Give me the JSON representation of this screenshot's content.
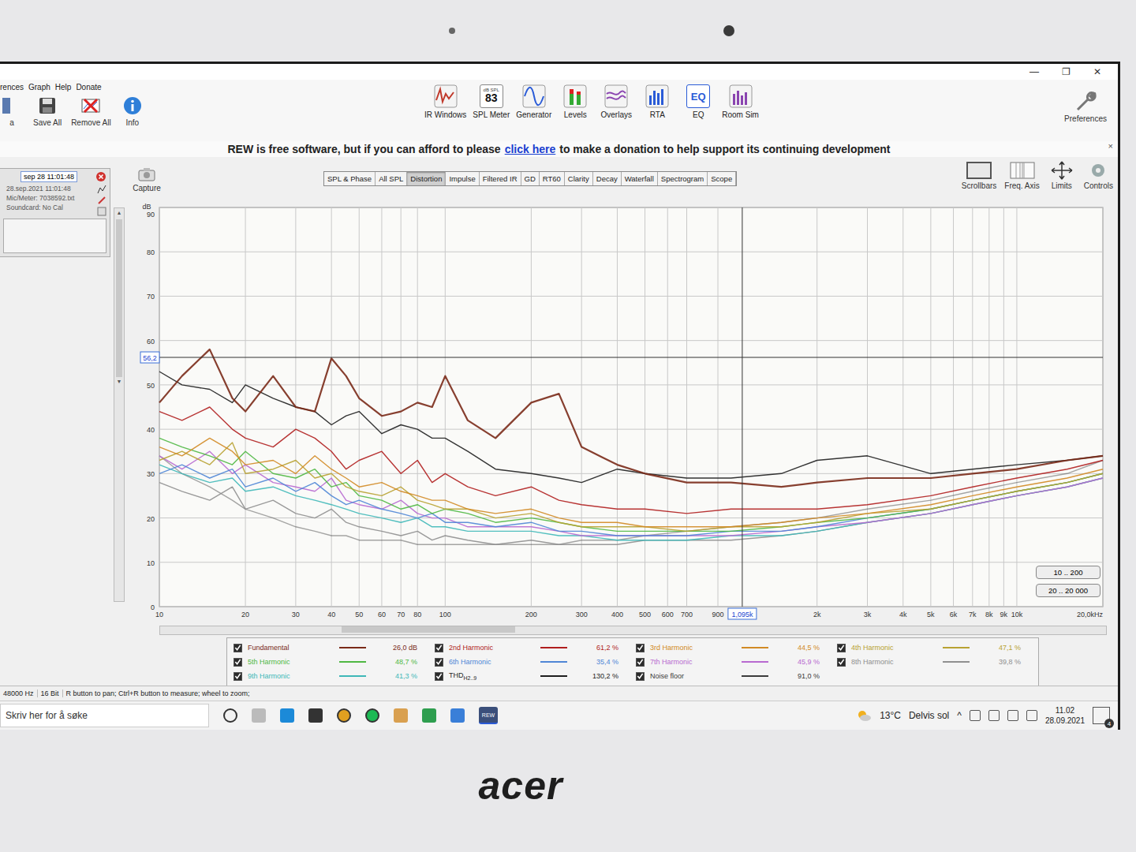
{
  "window": {
    "controls": [
      "—",
      "❐",
      "✕"
    ]
  },
  "menu": [
    "rences",
    "Graph",
    "Help",
    "Donate"
  ],
  "toolbar_left": [
    "a",
    "Save All",
    "Remove All",
    "Info"
  ],
  "tools": [
    {
      "label": "IR Windows",
      "icon_text": []
    },
    {
      "label": "SPL Meter",
      "icon_text": [
        "dB SPL",
        "83"
      ]
    },
    {
      "label": "Generator",
      "icon_text": []
    },
    {
      "label": "Levels",
      "icon_text": []
    },
    {
      "label": "Overlays",
      "icon_text": []
    },
    {
      "label": "RTA",
      "icon_text": []
    },
    {
      "label": "EQ",
      "icon_text": [
        "EQ"
      ]
    },
    {
      "label": "Room Sim",
      "icon_text": []
    }
  ],
  "preferences": "Preferences",
  "banner": {
    "before": "REW is free software, but if you can afford to please",
    "link": "click here",
    "after": "to make a donation to help support its continuing development",
    "close": "×"
  },
  "measurement": {
    "name": "sep 28 11:01:48",
    "lines": [
      "28.sep.2021 11:01:48",
      "Mic/Meter: 7038592.txt",
      "Soundcard: No Cal"
    ]
  },
  "capture": "Capture",
  "tabs": [
    {
      "label": "SPL & Phase",
      "selected": false
    },
    {
      "label": "All SPL",
      "selected": false
    },
    {
      "label": "Distortion",
      "selected": true
    },
    {
      "label": "Impulse",
      "selected": false
    },
    {
      "label": "Filtered IR",
      "selected": false
    },
    {
      "label": "GD",
      "selected": false
    },
    {
      "label": "RT60",
      "selected": false
    },
    {
      "label": "Clarity",
      "selected": false
    },
    {
      "label": "Decay",
      "selected": false
    },
    {
      "label": "Waterfall",
      "selected": false
    },
    {
      "label": "Spectrogram",
      "selected": false
    },
    {
      "label": "Scope",
      "selected": false
    }
  ],
  "graph_controls": [
    "Scrollbars",
    "Freq. Axis",
    "Limits",
    "Controls"
  ],
  "chart": {
    "y_label": "dB",
    "y_ticks": [
      "90",
      "80",
      "70",
      "60",
      "50",
      "40",
      "30",
      "20",
      "10",
      "0"
    ],
    "x_ticks": [
      {
        "label": "10",
        "hz": 10
      },
      {
        "label": "20",
        "hz": 20
      },
      {
        "label": "30",
        "hz": 30
      },
      {
        "label": "40",
        "hz": 40
      },
      {
        "label": "50",
        "hz": 50
      },
      {
        "label": "60",
        "hz": 60
      },
      {
        "label": "70",
        "hz": 70
      },
      {
        "label": "80",
        "hz": 80
      },
      {
        "label": "100",
        "hz": 100
      },
      {
        "label": "200",
        "hz": 200
      },
      {
        "label": "300",
        "hz": 300
      },
      {
        "label": "400",
        "hz": 400
      },
      {
        "label": "500",
        "hz": 500
      },
      {
        "label": "600",
        "hz": 600
      },
      {
        "label": "700",
        "hz": 700
      },
      {
        "label": "900",
        "hz": 900
      },
      {
        "label": "2k",
        "hz": 2000
      },
      {
        "label": "3k",
        "hz": 3000
      },
      {
        "label": "4k",
        "hz": 4000
      },
      {
        "label": "5k",
        "hz": 5000
      },
      {
        "label": "6k",
        "hz": 6000
      },
      {
        "label": "7k",
        "hz": 7000
      },
      {
        "label": "8k",
        "hz": 8000
      },
      {
        "label": "9k",
        "hz": 9000
      },
      {
        "label": "10k",
        "hz": 10000
      },
      {
        "label": "20,0kHz",
        "hz": 20000
      }
    ],
    "cursor": {
      "hz": 1095,
      "hz_label": "1,095k",
      "db": 56.2,
      "db_label": "56,2"
    },
    "range_buttons": [
      "10 .. 200",
      "20 .. 20 000"
    ],
    "freqs": [
      10,
      12,
      15,
      18,
      20,
      25,
      30,
      35,
      40,
      45,
      50,
      60,
      70,
      80,
      90,
      100,
      120,
      150,
      200,
      250,
      300,
      400,
      500,
      700,
      1000,
      1500,
      2000,
      3000,
      5000,
      7000,
      10000,
      15000,
      20000
    ],
    "series": [
      {
        "name": "Noise floor",
        "sub": "",
        "value": "91,0 %",
        "checked": true,
        "color": "#3c3c3c",
        "values": [
          34,
          30,
          27,
          24,
          22,
          20,
          18,
          17,
          16,
          16,
          15,
          15,
          15,
          14,
          14,
          14,
          14,
          14,
          14,
          14,
          15,
          15,
          16,
          17,
          18,
          19,
          20,
          22,
          24,
          26,
          28,
          30,
          33
        ]
      },
      {
        "name": "8th Harmonic",
        "sub": "",
        "value": "39,8 %",
        "checked": true,
        "color": "#8f8f8f",
        "values": [
          28,
          26,
          24,
          27,
          22,
          24,
          21,
          20,
          22,
          19,
          18,
          17,
          16,
          17,
          15,
          16,
          15,
          14,
          15,
          14,
          14,
          14,
          15,
          15,
          15,
          16,
          17,
          19,
          21,
          23,
          25,
          27,
          29
        ]
      },
      {
        "name": "9th Harmonic",
        "sub": "",
        "value": "41,3 %",
        "checked": true,
        "color": "#3fb8b8",
        "values": [
          32,
          30,
          28,
          29,
          26,
          27,
          25,
          24,
          23,
          22,
          21,
          20,
          19,
          20,
          18,
          18,
          17,
          17,
          17,
          16,
          16,
          15,
          15,
          15,
          16,
          16,
          17,
          19,
          21,
          23,
          25,
          27,
          29
        ]
      },
      {
        "name": "7th Harmonic",
        "sub": "",
        "value": "45,9 %",
        "checked": true,
        "color": "#b86ad0",
        "values": [
          34,
          31,
          35,
          30,
          32,
          28,
          27,
          26,
          29,
          24,
          23,
          22,
          24,
          21,
          20,
          20,
          18,
          18,
          18,
          17,
          16,
          16,
          16,
          16,
          16,
          17,
          18,
          19,
          21,
          23,
          25,
          27,
          29
        ]
      },
      {
        "name": "6th Harmonic",
        "sub": "",
        "value": "35,4 %",
        "checked": true,
        "color": "#4f86d6",
        "values": [
          30,
          32,
          29,
          31,
          27,
          29,
          26,
          28,
          25,
          23,
          24,
          22,
          21,
          20,
          21,
          19,
          19,
          18,
          19,
          17,
          17,
          16,
          16,
          16,
          17,
          17,
          18,
          20,
          22,
          24,
          26,
          28,
          30
        ]
      },
      {
        "name": "5th Harmonic",
        "sub": "",
        "value": "48,7 %",
        "checked": true,
        "color": "#4fb843",
        "values": [
          38,
          36,
          34,
          32,
          35,
          30,
          29,
          31,
          27,
          28,
          25,
          24,
          22,
          23,
          21,
          22,
          21,
          19,
          20,
          19,
          18,
          17,
          17,
          17,
          17,
          18,
          19,
          20,
          22,
          24,
          26,
          28,
          30
        ]
      },
      {
        "name": "4th Harmonic",
        "sub": "",
        "value": "47,1 %",
        "checked": true,
        "color": "#b8a232",
        "values": [
          33,
          35,
          32,
          37,
          30,
          31,
          33,
          29,
          30,
          27,
          26,
          25,
          27,
          24,
          23,
          22,
          22,
          20,
          21,
          19,
          18,
          18,
          18,
          17,
          18,
          18,
          19,
          21,
          22,
          24,
          26,
          28,
          30
        ]
      },
      {
        "name": "3rd Harmonic",
        "sub": "",
        "value": "44,5 %",
        "checked": true,
        "color": "#d28a24",
        "values": [
          36,
          34,
          38,
          35,
          32,
          33,
          30,
          34,
          31,
          29,
          27,
          28,
          26,
          25,
          24,
          24,
          22,
          21,
          22,
          20,
          19,
          19,
          18,
          18,
          18,
          19,
          20,
          21,
          23,
          25,
          27,
          29,
          31
        ]
      },
      {
        "name": "2nd Harmonic",
        "sub": "",
        "value": "61,2 %",
        "checked": true,
        "color": "#b01e1e",
        "values": [
          44,
          42,
          45,
          40,
          38,
          36,
          40,
          38,
          35,
          31,
          33,
          35,
          30,
          33,
          28,
          30,
          27,
          25,
          27,
          24,
          23,
          22,
          22,
          21,
          22,
          22,
          22,
          23,
          25,
          27,
          29,
          31,
          33
        ]
      },
      {
        "name": "THD",
        "sub": "H2..9",
        "value": "130,2 %",
        "checked": true,
        "color": "#1e1e1e",
        "values": [
          53,
          50,
          49,
          46,
          50,
          47,
          45,
          44,
          41,
          43,
          44,
          39,
          41,
          40,
          38,
          38,
          35,
          31,
          30,
          29,
          28,
          31,
          30,
          29,
          29,
          30,
          33,
          34,
          30,
          31,
          32,
          33,
          34
        ]
      },
      {
        "name": "Fundamental",
        "sub": "",
        "value": "26,0 dB",
        "checked": true,
        "color": "#7a2a18",
        "values": [
          46,
          52,
          58,
          47,
          44,
          52,
          45,
          44,
          56,
          52,
          47,
          43,
          44,
          46,
          45,
          52,
          42,
          38,
          46,
          48,
          36,
          32,
          30,
          28,
          28,
          27,
          28,
          29,
          29,
          30,
          31,
          33,
          34
        ]
      }
    ]
  },
  "legend_order": [
    "Fundamental",
    "2nd Harmonic",
    "3rd Harmonic",
    "4th Harmonic",
    "5th Harmonic",
    "6th Harmonic",
    "7th Harmonic",
    "8th Harmonic",
    "9th Harmonic",
    "THD",
    "Noise floor"
  ],
  "status_bar": [
    "48000 Hz",
    "16 Bit",
    "R button to pan; Ctrl+R button to measure; wheel to zoom;"
  ],
  "taskbar": {
    "search_placeholder": "Skriv her for å søke",
    "app_label": "REW",
    "temperature": "13°C",
    "weather": "Delvis sol",
    "tray_arrow": "^",
    "time": "11.02",
    "date": "28.09.2021",
    "notifications": "4"
  },
  "brand": "acer"
}
